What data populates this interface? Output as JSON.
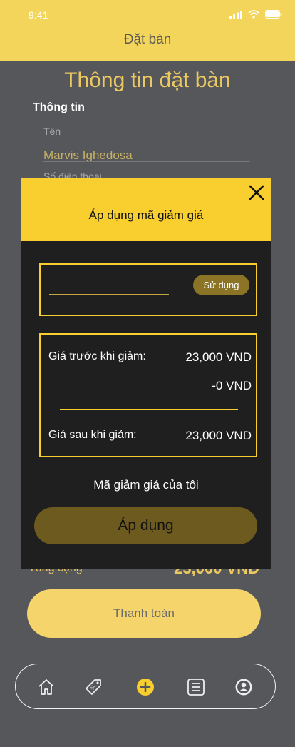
{
  "status_bar": {
    "time": "9:41"
  },
  "header": {
    "title": "Đặt bàn"
  },
  "page": {
    "title": "Thông tin đặt bàn",
    "section_label": "Thông tin",
    "name_label": "Tên",
    "name_value": "Marvis Ighedosa",
    "phone_label": "Số điện thoại",
    "total_label": "Tổng cộng",
    "total_value": "23,000 VND",
    "pay_button": "Thanh toán"
  },
  "modal": {
    "title": "Áp dụng mã giảm giá",
    "coupon_input_value": "",
    "coupon_input_placeholder": "",
    "use_button": "Sử dụng",
    "price_before_label": "Giá trước khi giảm:",
    "price_before_value": "23,000 VND",
    "discount_value": "-0 VND",
    "price_after_label": "Giá sau khi giảm:",
    "price_after_value": "23,000 VND",
    "my_coupons": "Mã giảm giá của tôi",
    "apply_button": "Áp dụng"
  },
  "nav": {
    "items": [
      {
        "icon": "home-icon"
      },
      {
        "icon": "coupon-tag-icon"
      },
      {
        "icon": "add-circle-icon"
      },
      {
        "icon": "list-icon"
      },
      {
        "icon": "profile-icon"
      }
    ]
  },
  "colors": {
    "accent_yellow": "#f8cf2e",
    "header_yellow": "#f4d55c",
    "modal_bg": "#1f1f1f",
    "page_bg": "#56575b"
  }
}
